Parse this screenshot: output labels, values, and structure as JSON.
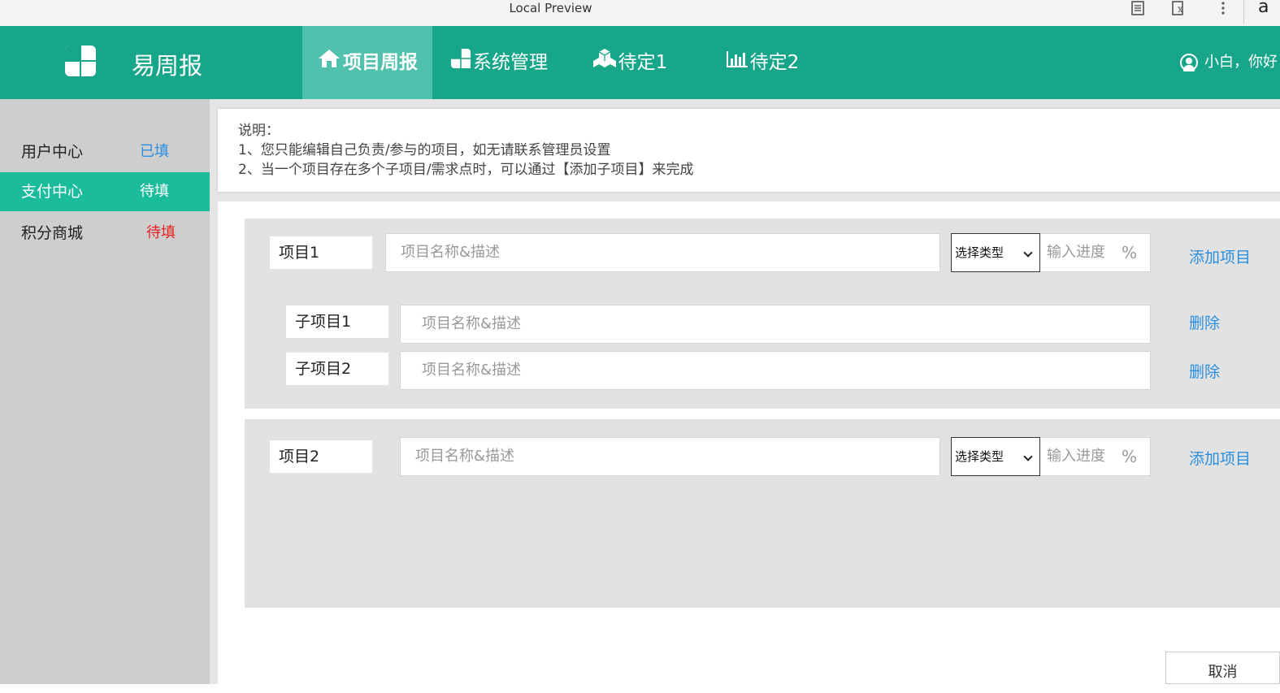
{
  "browser": {
    "title": "Local Preview",
    "right_text": "a"
  },
  "header": {
    "brand": "易周报",
    "nav": [
      {
        "label": "项目周报",
        "icon": "home-icon",
        "active": true
      },
      {
        "label": "系统管理",
        "icon": "logo-squares-icon",
        "active": false
      },
      {
        "label": "待定1",
        "icon": "cubes-icon",
        "active": false
      },
      {
        "label": "待定2",
        "icon": "bar-chart-icon",
        "active": false
      }
    ],
    "user_greeting": "小白，你好"
  },
  "sidebar": {
    "items": [
      {
        "label": "用户中心",
        "status": "已填",
        "status_color": "#2a8ee0",
        "active": false
      },
      {
        "label": "支付中心",
        "status": "待填",
        "status_color": "#ffffff",
        "active": true
      },
      {
        "label": "积分商城",
        "status": "待填",
        "status_color": "#e82020",
        "active": false
      }
    ]
  },
  "notice": {
    "lines": [
      "说明：",
      "1、您只能编辑自己负责/参与的项目，如无请联系管理员设置",
      "2、当一个项目存在多个子项目/需求点时，可以通过【添加子项目】来完成"
    ]
  },
  "projects": [
    {
      "label": "项目1",
      "name_placeholder": "项目名称&描述",
      "type_select": "选择类型",
      "progress_placeholder": "输入进度",
      "progress_unit": "%",
      "add_label": "添加项目",
      "subprojects": [
        {
          "label": "子项目1",
          "placeholder": "项目名称&描述",
          "delete_label": "删除"
        },
        {
          "label": "子项目2",
          "placeholder": "项目名称&描述",
          "delete_label": "删除"
        }
      ]
    },
    {
      "label": "项目2",
      "name_placeholder": "项目名称&描述",
      "type_select": "选择类型",
      "progress_placeholder": "输入进度",
      "progress_unit": "%",
      "add_label": "添加项目",
      "subprojects": []
    }
  ],
  "footer": {
    "cancel_label": "取消"
  },
  "colors": {
    "header": "#17a689",
    "nav_active": "#4fc1ad",
    "sidebar_active": "#1abc9c",
    "link": "#2a8ee0"
  }
}
